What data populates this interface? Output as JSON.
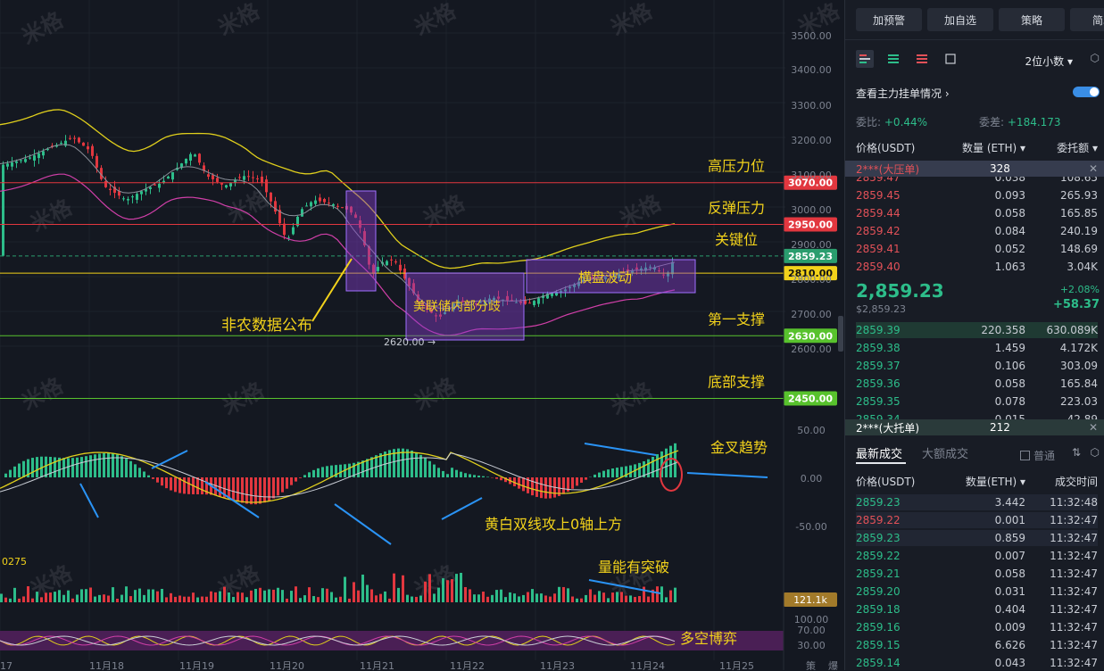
{
  "watermark": "米格",
  "price_axis": [
    "3500.00",
    "3400.00",
    "3300.00",
    "3200.00",
    "3100.00",
    "3000.00",
    "2900.00",
    "2800.00",
    "2700.00",
    "2600.00"
  ],
  "macd_axis": [
    "50.00",
    "0.00",
    "-50.00"
  ],
  "rsi_axis": [
    "100.00",
    "70.00",
    "30.00"
  ],
  "date_axis": [
    "17",
    "11月18",
    "11月19",
    "11月20",
    "11月21",
    "11月22",
    "11月23",
    "11月24",
    "11月25",
    "策",
    "爆"
  ],
  "levels": [
    {
      "name": "高压力位",
      "value": "3070.00",
      "color": "#e2373f"
    },
    {
      "name": "反弹压力",
      "value": "2950.00",
      "color": "#e2373f"
    },
    {
      "name": "关键位",
      "value": "2859.23",
      "color": "#2a9d6e"
    },
    {
      "name": "",
      "value": "2810.00",
      "color": "#f2d21b"
    },
    {
      "name": "第一支撑",
      "value": "2630.00",
      "color": "#58c22d"
    },
    {
      "name": "底部支撑",
      "value": "2450.00",
      "color": "#58c22d"
    }
  ],
  "annotations": {
    "nfp": "非农数据公布",
    "fed": "美联储内部分歧",
    "sideways": "横盘波动",
    "golden_cross": "金叉趋势",
    "lines_above_zero": "黄白双线攻上0轴上方",
    "volume_break": "量能有突破",
    "long_short": "多空博弈",
    "low_marker": "2620.00",
    "vol_value": "121.1k",
    "vol_label": "0275"
  },
  "panel": {
    "buttons": [
      "加预警",
      "加自选",
      "策略",
      "简况"
    ],
    "decimal": "2位小数",
    "depth_label": "查看主力挂单情况",
    "ratio_label": "委比:",
    "ratio_value": "+0.44%",
    "diff_label": "委差:",
    "diff_value": "+184.173",
    "book_headers": [
      "价格(USDT)",
      "数量 (ETH)",
      "委托额"
    ],
    "big_ask": {
      "label": "2***(大压单)",
      "qty": "328"
    },
    "asks": [
      {
        "price": "2859.47",
        "qty": "0.038",
        "total": "108.65"
      },
      {
        "price": "2859.45",
        "qty": "0.093",
        "total": "265.93"
      },
      {
        "price": "2859.44",
        "qty": "0.058",
        "total": "165.85"
      },
      {
        "price": "2859.42",
        "qty": "0.084",
        "total": "240.19"
      },
      {
        "price": "2859.41",
        "qty": "0.052",
        "total": "148.69"
      },
      {
        "price": "2859.40",
        "qty": "1.063",
        "total": "3.04K"
      }
    ],
    "last_price": "2,859.23",
    "last_price_sub": "$2,859.23",
    "change_pct": "+2.08%",
    "change_abs": "+58.37",
    "bids": [
      {
        "price": "2859.39",
        "qty": "220.358",
        "total": "630.089K"
      },
      {
        "price": "2859.38",
        "qty": "1.459",
        "total": "4.172K"
      },
      {
        "price": "2859.37",
        "qty": "0.106",
        "total": "303.09"
      },
      {
        "price": "2859.36",
        "qty": "0.058",
        "total": "165.84"
      },
      {
        "price": "2859.35",
        "qty": "0.078",
        "total": "223.03"
      },
      {
        "price": "2859.34",
        "qty": "0.015",
        "total": "42.89"
      }
    ],
    "big_bid": {
      "label": "2***(大托单)",
      "qty": "212"
    },
    "trade_tabs": [
      "最新成交",
      "大额成交"
    ],
    "normal_label": "普通",
    "trade_headers": [
      "价格(USDT)",
      "数量(ETH)",
      "成交时间"
    ],
    "trades": [
      {
        "price": "2859.23",
        "qty": "3.442",
        "time": "11:32:48",
        "side": "buy"
      },
      {
        "price": "2859.22",
        "qty": "0.001",
        "time": "11:32:47",
        "side": "sell"
      },
      {
        "price": "2859.23",
        "qty": "0.859",
        "time": "11:32:47",
        "side": "buy"
      },
      {
        "price": "2859.22",
        "qty": "0.007",
        "time": "11:32:47",
        "side": "buy"
      },
      {
        "price": "2859.21",
        "qty": "0.058",
        "time": "11:32:47",
        "side": "buy"
      },
      {
        "price": "2859.20",
        "qty": "0.031",
        "time": "11:32:47",
        "side": "buy"
      },
      {
        "price": "2859.18",
        "qty": "0.404",
        "time": "11:32:47",
        "side": "buy"
      },
      {
        "price": "2859.16",
        "qty": "0.009",
        "time": "11:32:47",
        "side": "buy"
      },
      {
        "price": "2859.15",
        "qty": "6.626",
        "time": "11:32:47",
        "side": "buy"
      },
      {
        "price": "2859.14",
        "qty": "0.043",
        "time": "11:32:47",
        "side": "buy"
      }
    ]
  }
}
